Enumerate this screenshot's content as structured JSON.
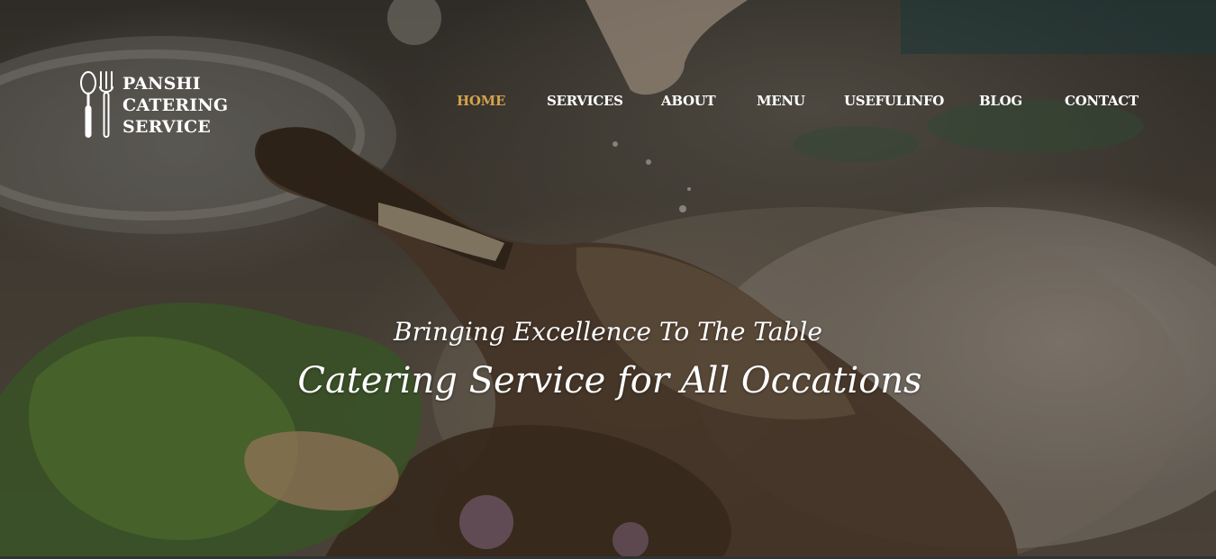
{
  "brand": {
    "line1": "PANSHI",
    "line2": "CATERING",
    "line3": "SERVICE",
    "icon": "spoon-fork-icon"
  },
  "nav": {
    "active_color": "#d4a24e",
    "items": [
      {
        "label": "HOME",
        "active": true
      },
      {
        "label": "SERVICES",
        "active": false
      },
      {
        "label": "ABOUT",
        "active": false
      },
      {
        "label": "MENU",
        "active": false
      },
      {
        "label": "USEFULINFO",
        "active": false
      },
      {
        "label": "BLOG",
        "active": false
      },
      {
        "label": "CONTACT",
        "active": false
      }
    ]
  },
  "hero": {
    "tagline": "Bringing Excellence To The Table",
    "headline": "Catering Service for All Occations"
  }
}
